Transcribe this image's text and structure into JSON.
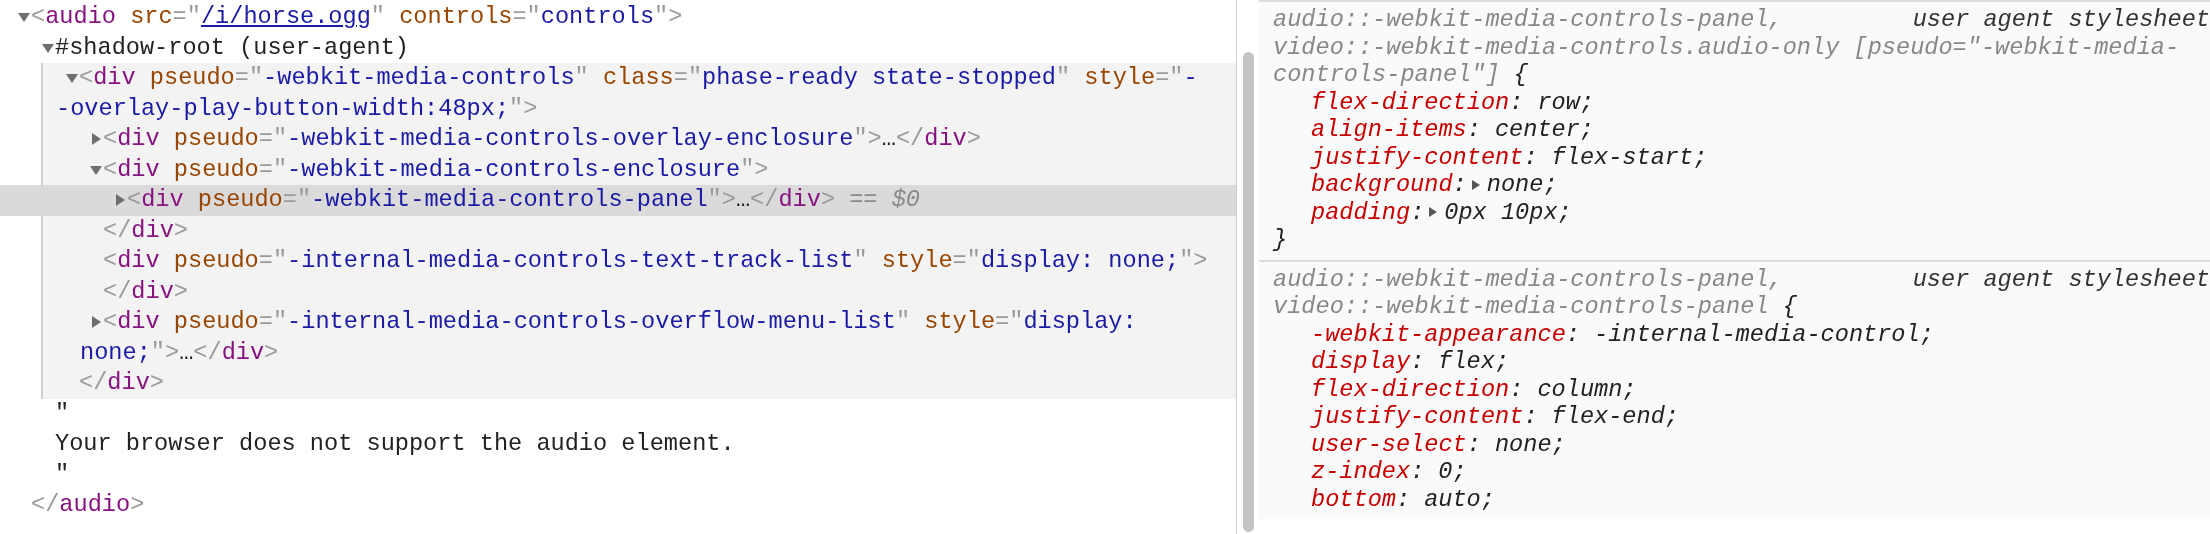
{
  "elements_panel": {
    "nodes": [
      {
        "kind": "element",
        "expanded": true,
        "selected": false,
        "lines": [
          [
            {
              "kind": "punct",
              "text": "<"
            },
            {
              "kind": "tag",
              "text": "audio"
            },
            {
              "kind": "attr",
              "text": " src"
            },
            {
              "kind": "punct",
              "text": "=\""
            },
            {
              "kind": "link",
              "text": "/i/horse.ogg"
            },
            {
              "kind": "punct",
              "text": "\""
            },
            {
              "kind": "attr",
              "text": " controls"
            },
            {
              "kind": "punct",
              "text": "=\""
            },
            {
              "kind": "value",
              "text": "controls"
            },
            {
              "kind": "punct",
              "text": "\">"
            }
          ]
        ],
        "children": [
          {
            "kind": "shadow-root",
            "expanded": true,
            "selected": false,
            "lines": [
              [
                {
                  "kind": "plain",
                  "text": "#shadow-root (user-agent)"
                }
              ]
            ],
            "children": [
              {
                "kind": "element",
                "expanded": true,
                "selected": false,
                "lines": [
                  [
                    {
                      "kind": "punct",
                      "text": "<"
                    },
                    {
                      "kind": "tag",
                      "text": "div"
                    },
                    {
                      "kind": "attr",
                      "text": " pseudo"
                    },
                    {
                      "kind": "punct",
                      "text": "=\""
                    },
                    {
                      "kind": "value",
                      "text": "-webkit-media-controls"
                    },
                    {
                      "kind": "punct",
                      "text": "\""
                    },
                    {
                      "kind": "attr",
                      "text": " class"
                    },
                    {
                      "kind": "punct",
                      "text": "=\""
                    },
                    {
                      "kind": "value",
                      "text": "phase-ready state-stopped"
                    },
                    {
                      "kind": "punct",
                      "text": "\""
                    },
                    {
                      "kind": "attr",
                      "text": " style"
                    },
                    {
                      "kind": "punct",
                      "text": "=\""
                    },
                    {
                      "kind": "value",
                      "text": "-"
                    }
                  ],
                  [
                    {
                      "kind": "value",
                      "text": "-overlay-play-button-width:48px;"
                    },
                    {
                      "kind": "punct",
                      "text": "\">"
                    }
                  ]
                ],
                "children": [
                  {
                    "kind": "element",
                    "expanded": false,
                    "selected": false,
                    "lines": [
                      [
                        {
                          "kind": "punct",
                          "text": "<"
                        },
                        {
                          "kind": "tag",
                          "text": "div"
                        },
                        {
                          "kind": "attr",
                          "text": " pseudo"
                        },
                        {
                          "kind": "punct",
                          "text": "=\""
                        },
                        {
                          "kind": "value",
                          "text": "-webkit-media-controls-overlay-enclosure"
                        },
                        {
                          "kind": "punct",
                          "text": "\">"
                        },
                        {
                          "kind": "plain",
                          "text": "…"
                        },
                        {
                          "kind": "punct",
                          "text": "</"
                        },
                        {
                          "kind": "tag",
                          "text": "div"
                        },
                        {
                          "kind": "punct",
                          "text": ">"
                        }
                      ]
                    ]
                  },
                  {
                    "kind": "element",
                    "expanded": true,
                    "selected": false,
                    "lines": [
                      [
                        {
                          "kind": "punct",
                          "text": "<"
                        },
                        {
                          "kind": "tag",
                          "text": "div"
                        },
                        {
                          "kind": "attr",
                          "text": " pseudo"
                        },
                        {
                          "kind": "punct",
                          "text": "=\""
                        },
                        {
                          "kind": "value",
                          "text": "-webkit-media-controls-enclosure"
                        },
                        {
                          "kind": "punct",
                          "text": "\">"
                        }
                      ]
                    ],
                    "children": [
                      {
                        "kind": "element",
                        "expanded": false,
                        "selected": true,
                        "lines": [
                          [
                            {
                              "kind": "punct",
                              "text": "<"
                            },
                            {
                              "kind": "tag",
                              "text": "div"
                            },
                            {
                              "kind": "attr",
                              "text": " pseudo"
                            },
                            {
                              "kind": "punct",
                              "text": "=\""
                            },
                            {
                              "kind": "value",
                              "text": "-webkit-media-controls-panel"
                            },
                            {
                              "kind": "punct",
                              "text": "\">"
                            },
                            {
                              "kind": "plain",
                              "text": "…"
                            },
                            {
                              "kind": "punct",
                              "text": "</"
                            },
                            {
                              "kind": "tag",
                              "text": "div"
                            },
                            {
                              "kind": "punct",
                              "text": ">"
                            },
                            {
                              "kind": "console",
                              "text": " == "
                            },
                            {
                              "kind": "var",
                              "text": "$0"
                            }
                          ]
                        ]
                      }
                    ],
                    "closing": [
                      [
                        {
                          "kind": "punct",
                          "text": "</"
                        },
                        {
                          "kind": "tag",
                          "text": "div"
                        },
                        {
                          "kind": "punct",
                          "text": ">"
                        }
                      ]
                    ]
                  },
                  {
                    "kind": "element",
                    "selected": false,
                    "lines": [
                      [
                        {
                          "kind": "punct",
                          "text": "<"
                        },
                        {
                          "kind": "tag",
                          "text": "div"
                        },
                        {
                          "kind": "attr",
                          "text": " pseudo"
                        },
                        {
                          "kind": "punct",
                          "text": "=\""
                        },
                        {
                          "kind": "value",
                          "text": "-internal-media-controls-text-track-list"
                        },
                        {
                          "kind": "punct",
                          "text": "\""
                        },
                        {
                          "kind": "attr",
                          "text": " style"
                        },
                        {
                          "kind": "punct",
                          "text": "=\""
                        },
                        {
                          "kind": "value",
                          "text": "display: none;"
                        },
                        {
                          "kind": "punct",
                          "text": "\">"
                        }
                      ]
                    ],
                    "closing": [
                      [
                        {
                          "kind": "punct",
                          "text": "</"
                        },
                        {
                          "kind": "tag",
                          "text": "div"
                        },
                        {
                          "kind": "punct",
                          "text": ">"
                        }
                      ]
                    ]
                  },
                  {
                    "kind": "element",
                    "expanded": false,
                    "selected": false,
                    "lines": [
                      [
                        {
                          "kind": "punct",
                          "text": "<"
                        },
                        {
                          "kind": "tag",
                          "text": "div"
                        },
                        {
                          "kind": "attr",
                          "text": " pseudo"
                        },
                        {
                          "kind": "punct",
                          "text": "=\""
                        },
                        {
                          "kind": "value",
                          "text": "-internal-media-controls-overflow-menu-list"
                        },
                        {
                          "kind": "punct",
                          "text": "\""
                        },
                        {
                          "kind": "attr",
                          "text": " style"
                        },
                        {
                          "kind": "punct",
                          "text": "=\""
                        },
                        {
                          "kind": "value",
                          "text": "display:"
                        }
                      ],
                      [
                        {
                          "kind": "value",
                          "text": "none;"
                        },
                        {
                          "kind": "punct",
                          "text": "\">"
                        },
                        {
                          "kind": "plain",
                          "text": "…"
                        },
                        {
                          "kind": "punct",
                          "text": "</"
                        },
                        {
                          "kind": "tag",
                          "text": "div"
                        },
                        {
                          "kind": "punct",
                          "text": ">"
                        }
                      ]
                    ]
                  }
                ],
                "closing": [
                  [
                    {
                      "kind": "punct",
                      "text": "</"
                    },
                    {
                      "kind": "tag",
                      "text": "div"
                    },
                    {
                      "kind": "punct",
                      "text": ">"
                    }
                  ]
                ]
              }
            ]
          },
          {
            "kind": "text",
            "selected": false,
            "lines": [
              [
                {
                  "kind": "plain",
                  "text": "\""
                }
              ],
              [
                {
                  "kind": "plain",
                  "text": "Your browser does not support the audio element."
                }
              ],
              [
                {
                  "kind": "plain",
                  "text": "\""
                }
              ]
            ]
          }
        ],
        "closing": [
          [
            {
              "kind": "punct",
              "text": "</"
            },
            {
              "kind": "tag",
              "text": "audio"
            },
            {
              "kind": "punct",
              "text": ">"
            }
          ]
        ]
      }
    ]
  },
  "styles_panel": {
    "rules": [
      {
        "selectors": [
          "audio::-webkit-media-controls-panel,",
          "video::-webkit-media-controls.audio-only [pseudo=\"-webkit-media-",
          "controls-panel\"]"
        ],
        "open_brace": "{",
        "origin": "user agent stylesheet",
        "close_brace": "}",
        "declarations": [
          {
            "property": "flex-direction",
            "colon": ":",
            "value": "row;",
            "expandable": false
          },
          {
            "property": "align-items",
            "colon": ":",
            "value": "center;",
            "expandable": false
          },
          {
            "property": "justify-content",
            "colon": ":",
            "value": "flex-start;",
            "expandable": false
          },
          {
            "property": "background",
            "colon": ":",
            "value": "none;",
            "expandable": true
          },
          {
            "property": "padding",
            "colon": ":",
            "value": "0px 10px;",
            "expandable": true
          }
        ]
      },
      {
        "selectors": [
          "audio::-webkit-media-controls-panel,",
          "video::-webkit-media-controls-panel"
        ],
        "open_brace": "{",
        "origin": "user agent stylesheet",
        "declarations": [
          {
            "property": "-webkit-appearance",
            "colon": ":",
            "value": "-internal-media-control;",
            "expandable": false
          },
          {
            "property": "display",
            "colon": ":",
            "value": "flex;",
            "expandable": false
          },
          {
            "property": "flex-direction",
            "colon": ":",
            "value": "column;",
            "expandable": false
          },
          {
            "property": "justify-content",
            "colon": ":",
            "value": "flex-end;",
            "expandable": false
          },
          {
            "property": "user-select",
            "colon": ":",
            "value": "none;",
            "expandable": false
          },
          {
            "property": "z-index",
            "colon": ":",
            "value": "0;",
            "expandable": false
          },
          {
            "property": "bottom",
            "colon": ":",
            "value": "auto;",
            "expandable": false
          }
        ]
      }
    ]
  }
}
